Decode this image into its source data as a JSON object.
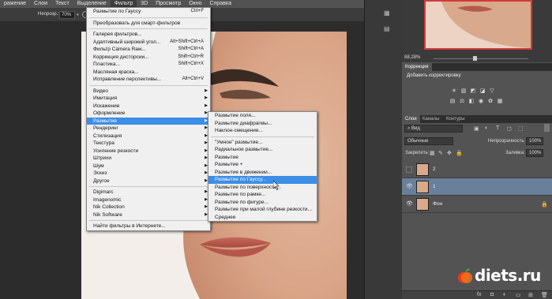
{
  "menubar": {
    "items": [
      "ражение",
      "Слои",
      "Текст",
      "Выделение",
      "Фильтр",
      "3D",
      "Просмотр",
      "Окно",
      "Справка"
    ]
  },
  "options": {
    "opacity_label": "Непрозр.:",
    "opacity_value": "70%"
  },
  "filter_menu": {
    "last_filter": {
      "label": "Размытие по Гауссу",
      "shortcut": "Ctrl+F"
    },
    "smart_filters": "Преобразовать для смарт-фильтров",
    "group1": [
      {
        "label": "Галерея фильтров...",
        "shortcut": ""
      },
      {
        "label": "Адаптивный широкий угол...",
        "shortcut": "Alt+Shift+Ctrl+A"
      },
      {
        "label": "Фильтр Camera Raw...",
        "shortcut": "Shift+Ctrl+A"
      },
      {
        "label": "Коррекция дисторсии...",
        "shortcut": "Shift+Ctrl+R"
      },
      {
        "label": "Пластика...",
        "shortcut": "Shift+Ctrl+X"
      },
      {
        "label": "Масляная краска...",
        "shortcut": ""
      },
      {
        "label": "Исправление перспективы...",
        "shortcut": "Alt+Ctrl+V"
      }
    ],
    "group2": [
      "Видео",
      "Имитация",
      "Искажение",
      "Оформление",
      "Размытие",
      "Рендеринг",
      "Стилизация",
      "Текстура",
      "Усиление резкости",
      "Штрихи",
      "Шум",
      "Эскиз",
      "Другое"
    ],
    "group3": [
      "Digimarc",
      "Imagenomic",
      "Nik Collection",
      "Nik Software"
    ],
    "browse": "Найти фильтры в Интернете..."
  },
  "blur_menu": {
    "group1": [
      "Размытие поля...",
      "Размытие диафрагмы...",
      "Наклон-смещение..."
    ],
    "group2": [
      "\"Умное\" размытие...",
      "Радиальное размытие...",
      "Размытие",
      "Размытие +",
      "Размытие в движении...",
      "Размытие по Гауссу...",
      "Размытие по поверхности...",
      "Размытие по рамке...",
      "Размытие по фигуре...",
      "Размытие при малой глубине резкости...",
      "Среднее"
    ]
  },
  "navigator": {
    "zoom": "88,28%"
  },
  "adjustments": {
    "tab": "Коррекция",
    "subtitle": "Добавить корректировку"
  },
  "layers_panel": {
    "tabs": [
      "Слои",
      "Каналы",
      "Контуры"
    ],
    "kind": "Вид",
    "blend_mode": "Обычные",
    "opacity_label": "Непрозрачность:",
    "opacity_value": "100%",
    "lock_label": "Закрепить:",
    "fill_label": "Заливка:",
    "fill_value": "100%",
    "layers": [
      {
        "name": "2",
        "visible": false,
        "selected": false
      },
      {
        "name": "1",
        "visible": true,
        "selected": true
      },
      {
        "name": "Фон",
        "visible": true,
        "selected": false
      }
    ]
  },
  "watermark": "diets.ru",
  "colors": {
    "menu_highlight": "#3d8ee6",
    "selected_layer": "#6a7f99",
    "thumb_border": "#d23a3a"
  }
}
